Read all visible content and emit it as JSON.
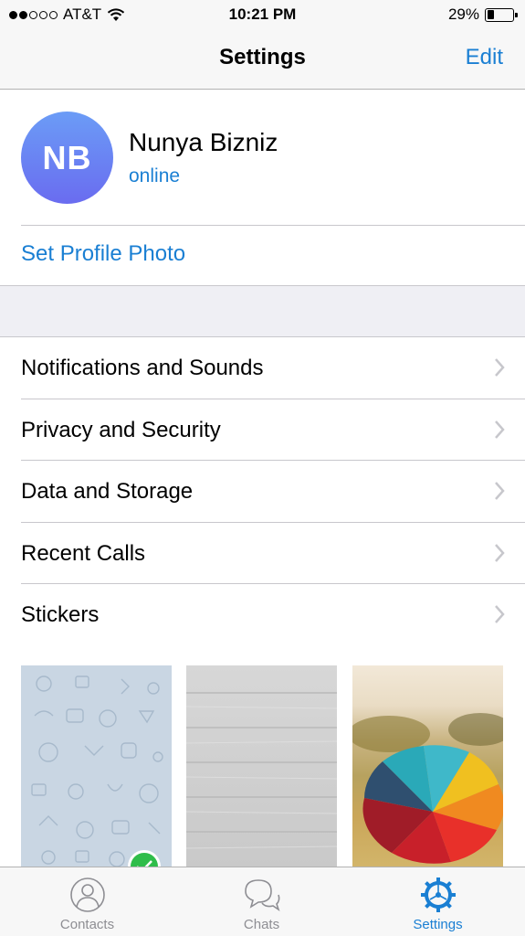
{
  "status_bar": {
    "carrier": "AT&T",
    "time": "10:21 PM",
    "battery_percent": "29%",
    "battery_level": 0.29,
    "signal_bars_filled": 2,
    "signal_bars_total": 5
  },
  "nav": {
    "title": "Settings",
    "edit_label": "Edit"
  },
  "profile": {
    "initials": "NB",
    "name": "Nunya Bizniz",
    "status": "online",
    "set_photo_label": "Set Profile Photo"
  },
  "menu": {
    "items": [
      {
        "label": "Notifications and Sounds"
      },
      {
        "label": "Privacy and Security"
      },
      {
        "label": "Data and Storage"
      },
      {
        "label": "Recent Calls"
      },
      {
        "label": "Stickers"
      }
    ]
  },
  "wallpapers": {
    "selected_index": 0
  },
  "tabs": [
    {
      "label": "Contacts",
      "icon": "person-icon"
    },
    {
      "label": "Chats",
      "icon": "chat-bubbles-icon"
    },
    {
      "label": "Settings",
      "icon": "gear-icon"
    }
  ],
  "colors": {
    "accent": "#1a7fd3",
    "avatar_top": "#6b9cf6",
    "avatar_bottom": "#6a6cf0",
    "check": "#2fbd4a"
  }
}
